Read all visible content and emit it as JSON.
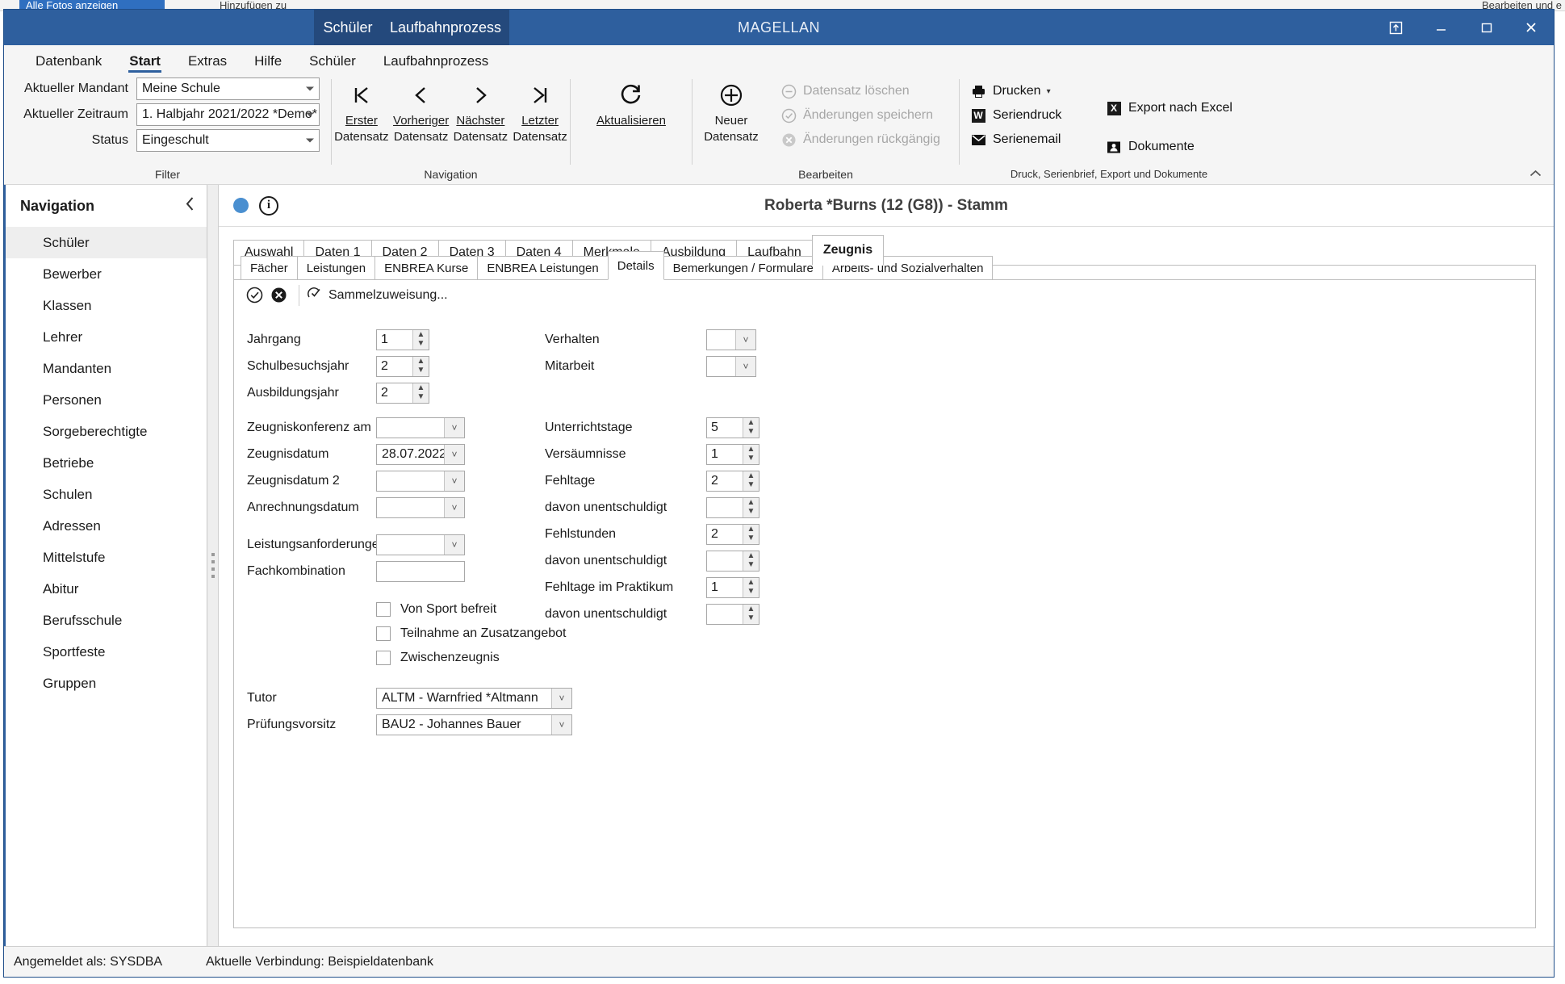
{
  "background": {
    "left_tab": "Alle Fotos anzeigen",
    "center_text": "Hinzufügen zu",
    "right_text": "Bearbeiten und e"
  },
  "window": {
    "title": "MAGELLAN",
    "title_tabs": [
      "Schüler",
      "Laufbahnprozess"
    ],
    "controls": {
      "restore_down_label": "restore-window",
      "minimize_label": "minimize",
      "maximize_label": "maximize",
      "close_label": "close"
    }
  },
  "menubar": {
    "items": [
      {
        "label": "Datenbank",
        "active": false
      },
      {
        "label": "Start",
        "active": true
      },
      {
        "label": "Extras",
        "active": false
      },
      {
        "label": "Hilfe",
        "active": false
      },
      {
        "label": "Schüler",
        "active": false
      },
      {
        "label": "Laufbahnprozess",
        "active": false
      }
    ]
  },
  "ribbon": {
    "filter": {
      "group_label": "Filter",
      "rows": [
        {
          "label": "Aktueller Mandant",
          "value": "Meine Schule"
        },
        {
          "label": "Aktueller Zeitraum",
          "value": "1. Halbjahr 2021/2022 *Demo*"
        },
        {
          "label": "Status",
          "value": "Eingeschult"
        }
      ]
    },
    "navigation": {
      "group_label": "Navigation",
      "buttons": [
        {
          "icon": "first-record-icon",
          "glyph": "|❮",
          "line1": "Erster",
          "line2": "Datensatz"
        },
        {
          "icon": "previous-record-icon",
          "glyph": "❮",
          "line1": "Vorheriger",
          "line2": "Datensatz"
        },
        {
          "icon": "next-record-icon",
          "glyph": "❯",
          "line1": "Nächster",
          "line2": "Datensatz"
        },
        {
          "icon": "last-record-icon",
          "glyph": "❯|",
          "line1": "Letzter",
          "line2": "Datensatz"
        },
        {
          "icon": "refresh-icon",
          "glyph": "⟳",
          "line1": "Aktualisieren",
          "line2": ""
        }
      ]
    },
    "edit": {
      "group_label": "Bearbeiten",
      "new_record": {
        "icon": "plus-circle-icon",
        "glyph": "⊕",
        "line1": "Neuer",
        "line2": "Datensatz"
      },
      "items": [
        {
          "label": "Datensatz löschen",
          "icon": "minus-circle-icon",
          "glyph": "⊖",
          "disabled": true
        },
        {
          "label": "Änderungen speichern",
          "icon": "check-circle-icon",
          "glyph": "✔",
          "disabled": true
        },
        {
          "label": "Änderungen rückgängig",
          "icon": "cancel-circle-icon",
          "glyph": "✕",
          "disabled": true
        }
      ]
    },
    "print": {
      "group_label": "Druck, Serienbrief, Export und Dokumente",
      "col1": [
        {
          "label": "Drucken",
          "icon": "printer-icon",
          "glyph": "⎙",
          "has_caret": true
        },
        {
          "label": "Seriendruck",
          "icon": "word-icon",
          "badge": "W"
        },
        {
          "label": "Serienemail",
          "icon": "mail-icon",
          "glyph": "✉"
        }
      ],
      "col2": [
        {
          "label": "Export nach Excel",
          "icon": "excel-icon",
          "badge": "X"
        },
        {
          "label": "Dokumente",
          "icon": "documents-icon",
          "badge": "▤"
        }
      ]
    },
    "collapse_icon": "chevron-up-icon"
  },
  "sidebar": {
    "title": "Navigation",
    "collapse_icon": "chevron-left-icon",
    "items": [
      {
        "label": "Schüler",
        "active": true
      },
      {
        "label": "Bewerber",
        "active": false
      },
      {
        "label": "Klassen",
        "active": false
      },
      {
        "label": "Lehrer",
        "active": false
      },
      {
        "label": "Mandanten",
        "active": false
      },
      {
        "label": "Personen",
        "active": false
      },
      {
        "label": "Sorgeberechtigte",
        "active": false
      },
      {
        "label": "Betriebe",
        "active": false
      },
      {
        "label": "Schulen",
        "active": false
      },
      {
        "label": "Adressen",
        "active": false
      },
      {
        "label": "Mittelstufe",
        "active": false
      },
      {
        "label": "Abitur",
        "active": false
      },
      {
        "label": "Berufsschule",
        "active": false
      },
      {
        "label": "Sportfeste",
        "active": false
      },
      {
        "label": "Gruppen",
        "active": false
      }
    ]
  },
  "record": {
    "title": "Roberta *Burns (12 (G8)) - Stamm",
    "status_dot": "blue",
    "info_icon_label": "i"
  },
  "outer_tabs": [
    {
      "label": "Auswahl",
      "active": false
    },
    {
      "label": "Daten 1",
      "active": false
    },
    {
      "label": "Daten 2",
      "active": false
    },
    {
      "label": "Daten 3",
      "active": false
    },
    {
      "label": "Daten 4",
      "active": false
    },
    {
      "label": "Merkmale",
      "active": false
    },
    {
      "label": "Ausbildung",
      "active": false
    },
    {
      "label": "Laufbahn",
      "active": false
    },
    {
      "label": "Zeugnis",
      "active": true
    }
  ],
  "inner_tabs": [
    {
      "label": "Fächer",
      "active": false
    },
    {
      "label": "Leistungen",
      "active": false
    },
    {
      "label": "ENBREA Kurse",
      "active": false
    },
    {
      "label": "ENBREA Leistungen",
      "active": false
    },
    {
      "label": "Details",
      "active": true
    },
    {
      "label": "Bemerkungen / Formulare",
      "active": false
    },
    {
      "label": "Arbeits- und Sozialverhalten",
      "active": false
    }
  ],
  "inner_toolbar": {
    "accept_icon": "check-circle-icon",
    "cancel_icon": "cancel-circle-icon",
    "bulk_assign": {
      "icon": "bulk-assign-icon",
      "glyph": "✇",
      "label": "Sammelzuweisung..."
    }
  },
  "form": {
    "left": {
      "spinners": [
        {
          "label": "Jahrgang",
          "value": "1"
        },
        {
          "label": "Schulbesuchsjahr",
          "value": "2"
        },
        {
          "label": "Ausbildungsjahr",
          "value": "2"
        }
      ],
      "dates": [
        {
          "label": "Zeugniskonferenz am",
          "value": ""
        },
        {
          "label": "Zeugnisdatum",
          "value": "28.07.2022"
        },
        {
          "label": "Zeugnisdatum 2",
          "value": ""
        },
        {
          "label": "Anrechnungsdatum",
          "value": ""
        }
      ],
      "leistungsanforderungen": {
        "label": "Leistungsanforderungen",
        "value": ""
      },
      "fachkombination": {
        "label": "Fachkombination",
        "value": ""
      },
      "checkboxes": [
        {
          "label": "Von Sport befreit",
          "checked": false
        },
        {
          "label": "Teilnahme an Zusatzangebot",
          "checked": false
        },
        {
          "label": "Zwischenzeugnis",
          "checked": false
        }
      ],
      "selects": [
        {
          "label": "Tutor",
          "value": "ALTM - Warnfried *Altmann"
        },
        {
          "label": "Prüfungsvorsitz",
          "value": "BAU2 - Johannes Bauer"
        }
      ]
    },
    "right": {
      "grades": [
        {
          "label": "Verhalten",
          "value": ""
        },
        {
          "label": "Mitarbeit",
          "value": ""
        }
      ],
      "counters": [
        {
          "label": "Unterrichtstage",
          "value": "5"
        },
        {
          "label": "Versäumnisse",
          "value": "1"
        },
        {
          "label": "Fehltage",
          "value": "2"
        },
        {
          "label": "davon unentschuldigt",
          "value": ""
        },
        {
          "label": "Fehlstunden",
          "value": "2"
        },
        {
          "label": "davon unentschuldigt",
          "value": ""
        },
        {
          "label": "Fehltage im Praktikum",
          "value": "1"
        },
        {
          "label": "davon unentschuldigt",
          "value": ""
        }
      ]
    }
  },
  "statusbar": {
    "logged_in": "Angemeldet als: SYSDBA",
    "connection": "Aktuelle Verbindung: Beispieldatenbank"
  },
  "colors": {
    "titlebar": "#2e5f9e",
    "titletab": "#24497c",
    "accent": "#2e5f9e",
    "record_dot": "#4a8fd0"
  }
}
